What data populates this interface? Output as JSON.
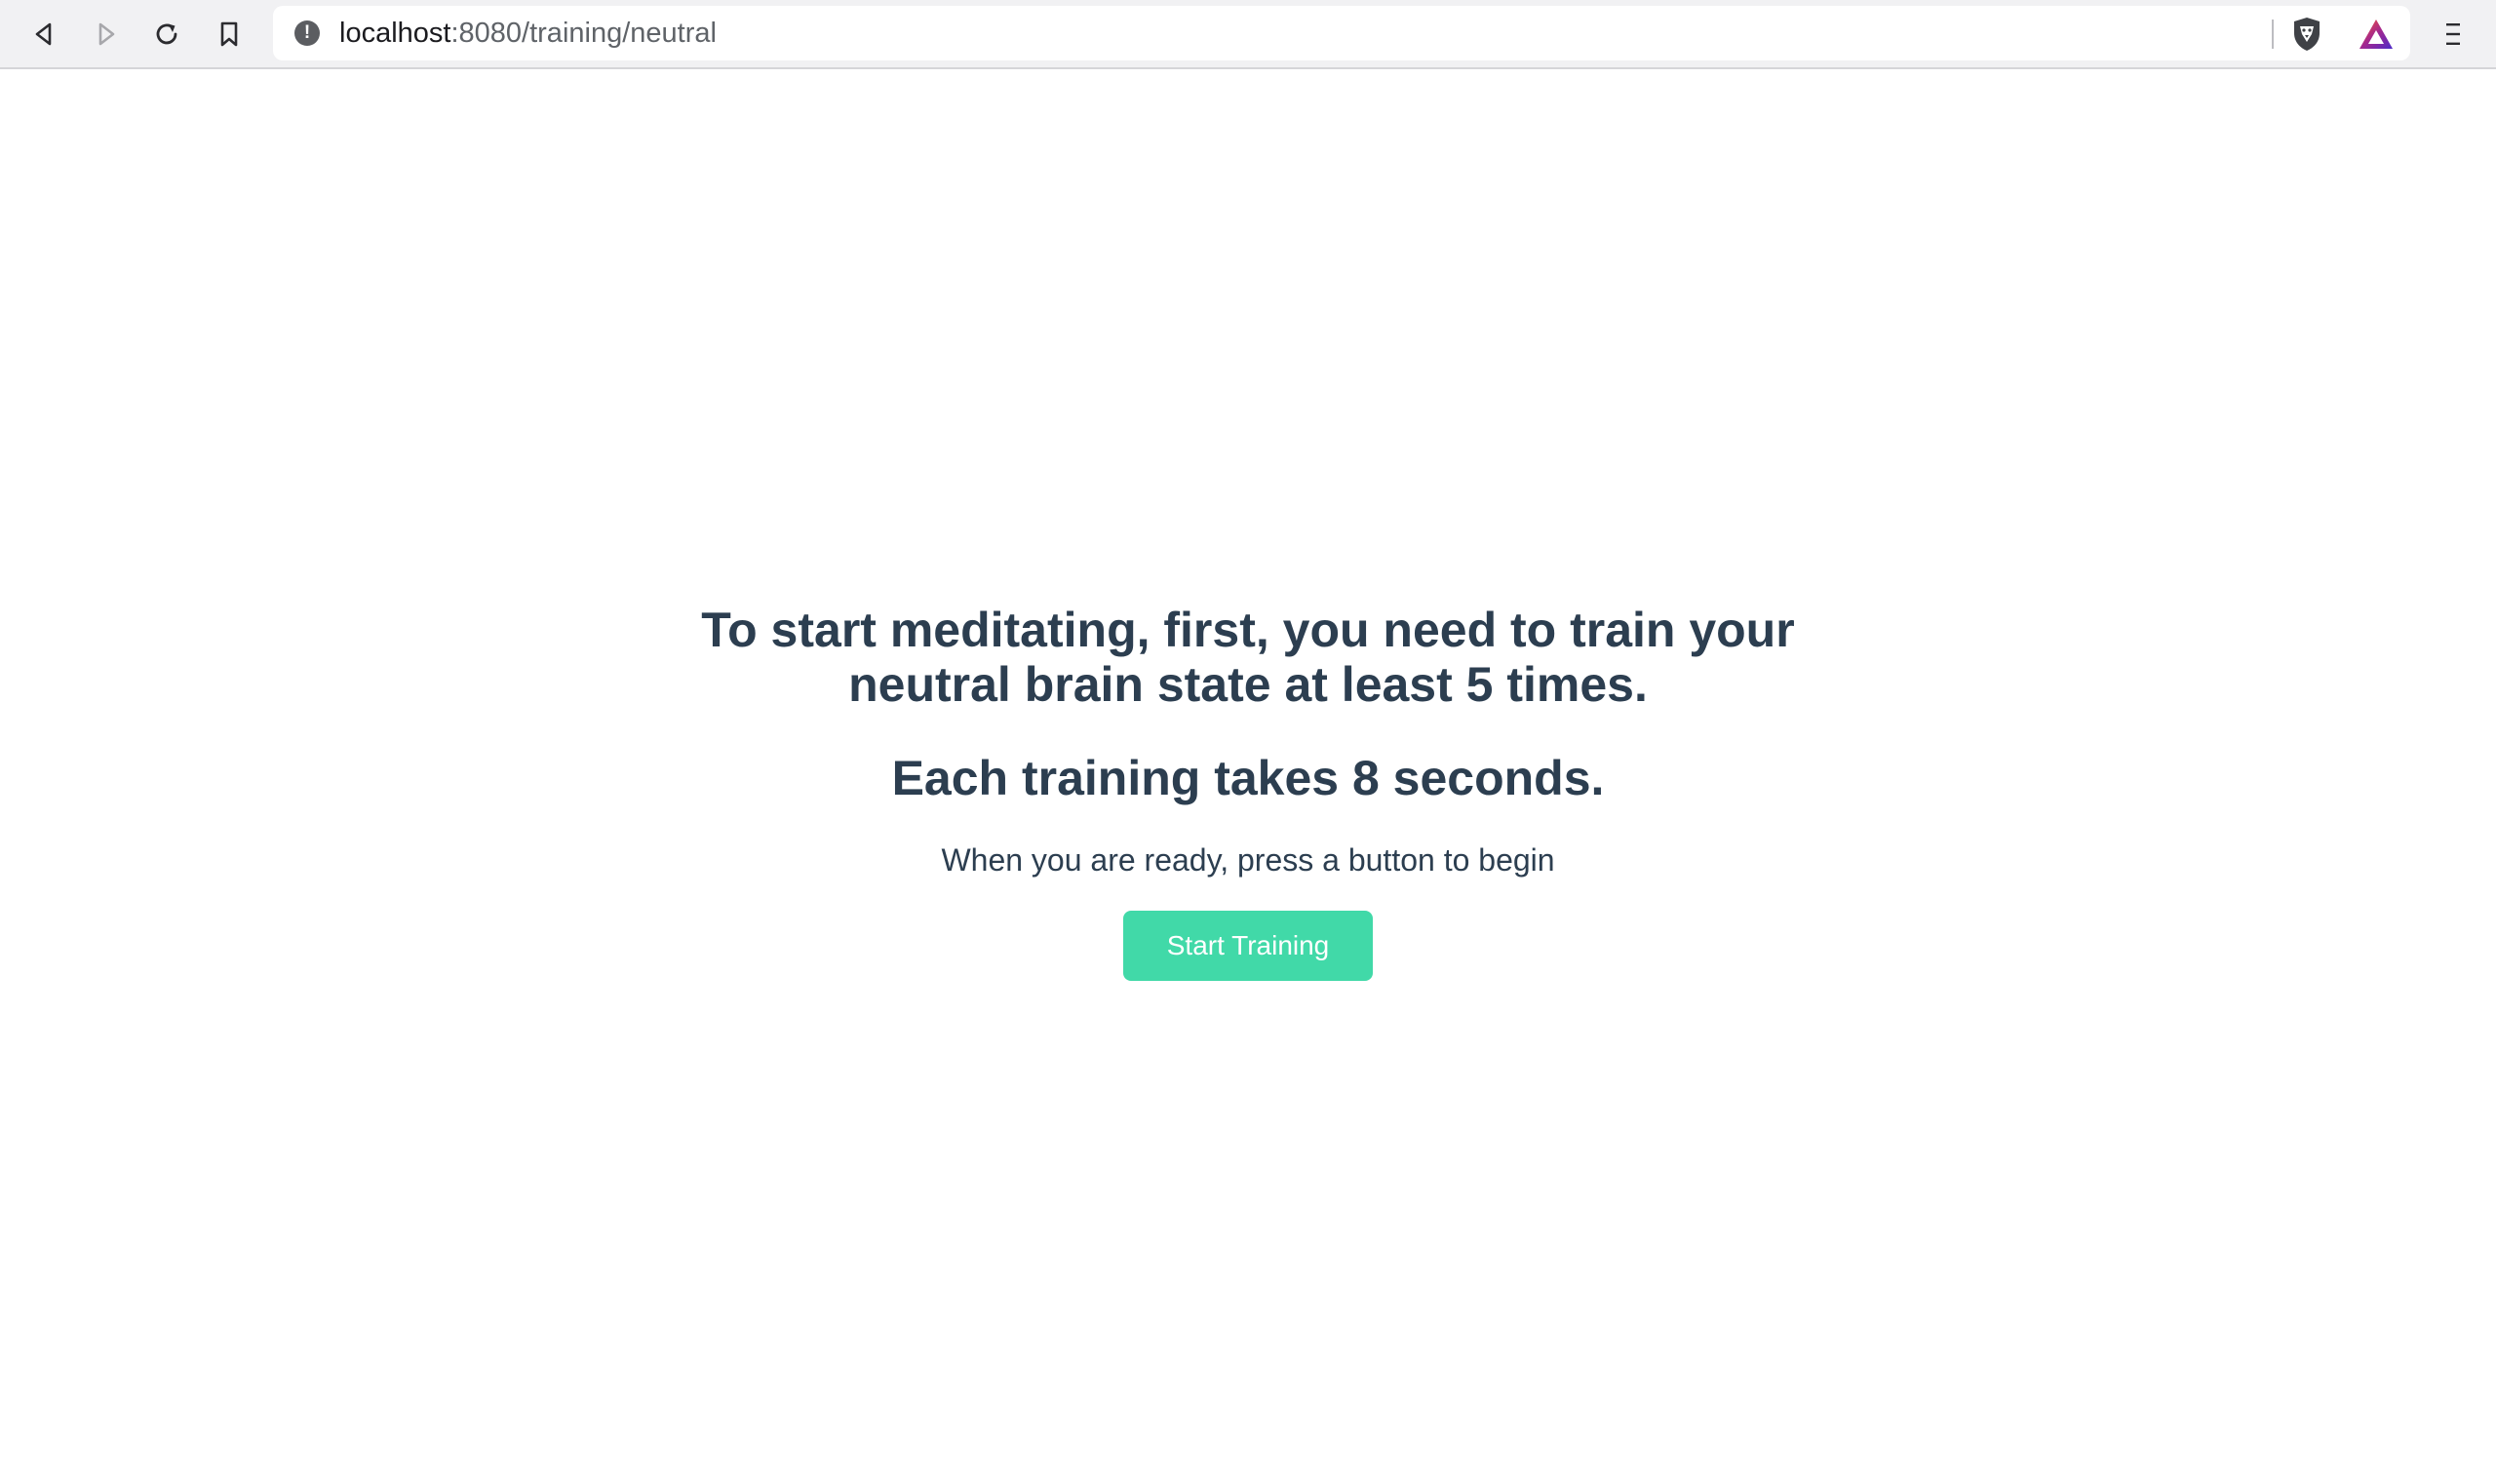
{
  "browser": {
    "url_host": "localhost",
    "url_path": ":8080/training/neutral",
    "icons": {
      "back": "back-arrow-icon",
      "forward": "forward-arrow-icon",
      "reload": "reload-icon",
      "bookmark": "bookmark-icon",
      "site_info": "info-icon",
      "shields": "brave-shield-icon",
      "rewards": "brave-rewards-icon",
      "menu": "hamburger-menu-icon"
    },
    "site_info_glyph": "!"
  },
  "page": {
    "headline": "To start meditating, first, you need to train your neutral brain state at least 5 times.",
    "subhead": "Each training takes 8 seconds.",
    "instruction": "When you are ready, press a button to begin",
    "start_button_label": "Start Training"
  },
  "colors": {
    "text": "#2c3e50",
    "button": "#41d9a8",
    "button_text": "#ffffff",
    "toolbar": "#f1f1f3"
  }
}
